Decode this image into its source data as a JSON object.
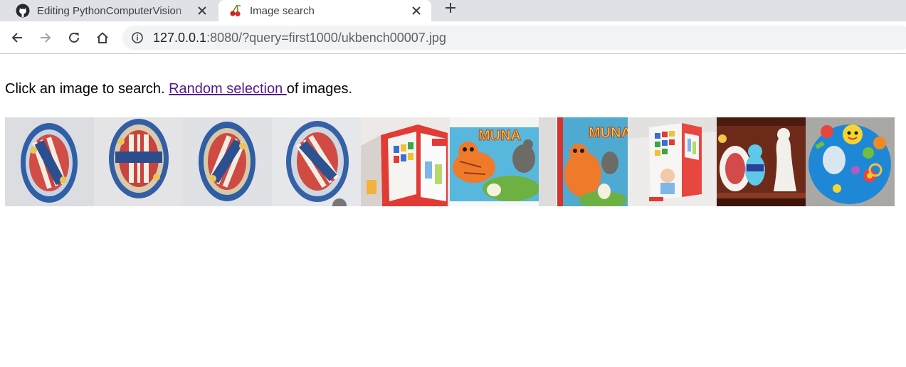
{
  "browser": {
    "tabs": [
      {
        "title": "Editing PythonComputerVision",
        "icon": "github-icon",
        "active": false
      },
      {
        "title": "Image search",
        "icon": "cherries-icon",
        "active": true
      }
    ],
    "url": {
      "host": "127.0.0.1",
      "rest": ":8080/?query=first1000/ukbench00007.jpg"
    }
  },
  "page": {
    "intro_before": "Click an image to search. ",
    "link_label": "Random selection ",
    "intro_after": "of images."
  },
  "results": [
    {
      "subject": "round tin, AMERICA"
    },
    {
      "subject": "round tin, AMERICA"
    },
    {
      "subject": "round tin, AMERICA"
    },
    {
      "subject": "round tin, AMERICA"
    },
    {
      "subject": "toy box"
    },
    {
      "subject": "book MUNA"
    },
    {
      "subject": "book MUNA"
    },
    {
      "subject": "toy box"
    },
    {
      "subject": "figurines on shelf"
    },
    {
      "subject": "baby toy"
    }
  ],
  "colors": {
    "tabstrip": "#dee1e6",
    "omnibox": "#f1f3f4",
    "visited_link": "#551a8b"
  }
}
